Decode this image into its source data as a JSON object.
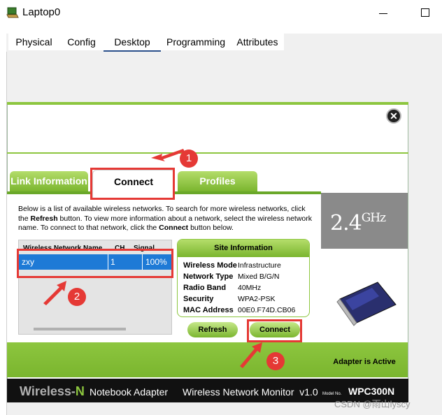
{
  "window": {
    "title": "Laptop0",
    "tabs": [
      "Physical",
      "Config",
      "Desktop",
      "Programming",
      "Attributes"
    ]
  },
  "monitor": {
    "tabs": {
      "link_info": "Link Information",
      "connect": "Connect",
      "profiles": "Profiles"
    },
    "intro": {
      "p1": "Below is a list of available wireless networks. To search for more wireless networks, click the ",
      "refresh_word": "Refresh",
      "p2": " button. To view more information about a network, select the wireless network name. To connect to that network, click the ",
      "connect_word": "Connect",
      "p3": " button below."
    },
    "network_table": {
      "headers": [
        "Wireless Network Name",
        "CH",
        "Signal"
      ],
      "rows": [
        {
          "name": "zxy",
          "ch": "1",
          "signal": "100%"
        }
      ]
    },
    "site_info": {
      "title": "Site Information",
      "labels": [
        "Wireless Mode",
        "Network Type",
        "Radio Band",
        "Security",
        "MAC Address"
      ],
      "values": [
        "Infrastructure",
        "Mixed B/G/N",
        "40MHz",
        "WPA2-PSK",
        "00E0.F74D.CB06"
      ]
    },
    "buttons": {
      "refresh": "Refresh",
      "connect": "Connect"
    },
    "band": {
      "main": "2.4",
      "unit": "GHz"
    },
    "status": "Adapter is Active",
    "footer": {
      "brand_wireless": "Wireless-",
      "brand_n": "N",
      "notebook": "Notebook Adapter",
      "monitor_name": "Wireless Network Monitor  v1.0",
      "model_label": "Model No.",
      "model": "WPC300N"
    }
  },
  "annotations": [
    "1",
    "2",
    "3"
  ],
  "watermark": "CSDN @雨山lyscy",
  "colors": {
    "green": "#8dc63f",
    "annotation_red": "#e53935",
    "selected_row": "#1e7ad6"
  }
}
